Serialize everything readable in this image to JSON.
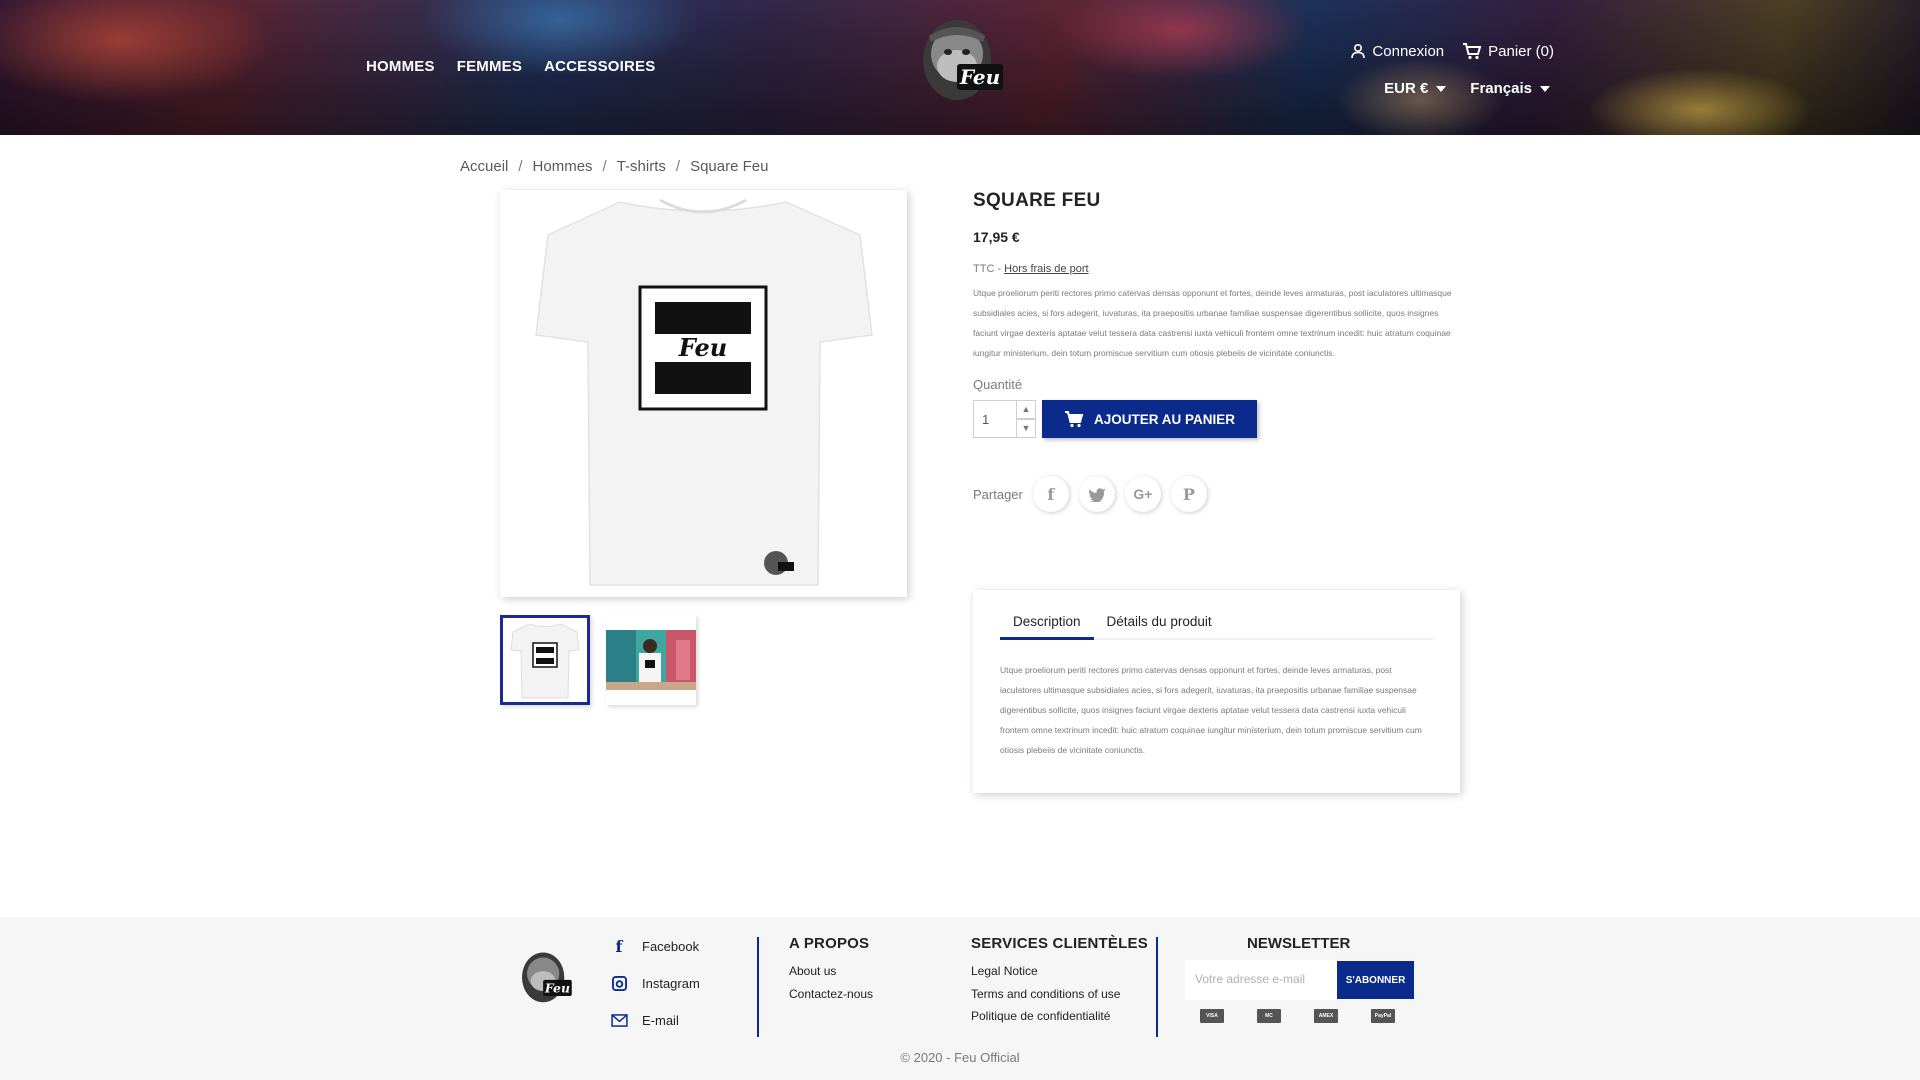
{
  "header": {
    "nav": [
      "HOMMES",
      "FEMMES",
      "ACCESSOIRES"
    ],
    "logo_text": "Feu",
    "login": "Connexion",
    "cart": "Panier (0)",
    "currency": "EUR €",
    "language": "Français"
  },
  "breadcrumb": [
    "Accueil",
    "Hommes",
    "T-shirts",
    "Square Feu"
  ],
  "product": {
    "title": "SQUARE FEU",
    "price": "17,95 €",
    "tax_prefix": "TTC - ",
    "shipping_link": "Hors frais de port",
    "short_description": "Utque proeliorum periti rectores primo catervas densas opponunt et fortes, deinde leves armaturas, post iaculatores ultimasque subsidiales acies, si fors adegerit, iuvaturas, ita praepositis urbanae familiae suspensae digerentibus sollicite, quos insignes faciunt virgae dexteris aptatae velut tessera data castrensi iuxta vehiculi frontem omne textrinum incedit: huic atratum coquinae iungitur ministerium, dein totum promiscue servitium cum otiosis plebeiis de vicinitate coniunctis.",
    "quantity_label": "Quantité",
    "quantity_value": "1",
    "add_to_cart": "AJOUTER AU PANIER",
    "share_label": "Partager",
    "image_text": "Feu"
  },
  "tabs": {
    "items": [
      "Description",
      "Détails du produit"
    ],
    "active": "Description",
    "content": "Utque proeliorum periti rectores primo catervas densas opponunt et fortes, deinde leves armaturas, post iaculatores ultimasque subsidiales acies, si fors adegerit, iuvaturas, ita praepositis urbanae familiae suspensae digerentibus sollicite, quos insignes faciunt virgae dexteris aptatae velut tessera data castrensi iuxta vehiculi frontem omne textrinum incedit: huic atratum coquinae iungitur ministerium, dein totum promiscue servitium cum otiosis plebeiis de vicinitate coniunctis."
  },
  "footer": {
    "social": [
      "Facebook",
      "Instagram",
      "E-mail"
    ],
    "about": {
      "title": "A PROPOS",
      "links": [
        "About us",
        "Contactez-nous"
      ]
    },
    "services": {
      "title": "SERVICES CLIENTÈLES",
      "links": [
        "Legal Notice",
        "Terms and conditions of use",
        "Politique de confidentialité"
      ]
    },
    "newsletter": {
      "title": "NEWSLETTER",
      "placeholder": "Votre adresse e-mail",
      "button": "S'ABONNER"
    },
    "payments": [
      "VISA",
      "MC",
      "AMEX",
      "PayPal"
    ],
    "copyright": "© 2020 - Feu Official"
  },
  "colors": {
    "accent": "#0a2a8c"
  }
}
